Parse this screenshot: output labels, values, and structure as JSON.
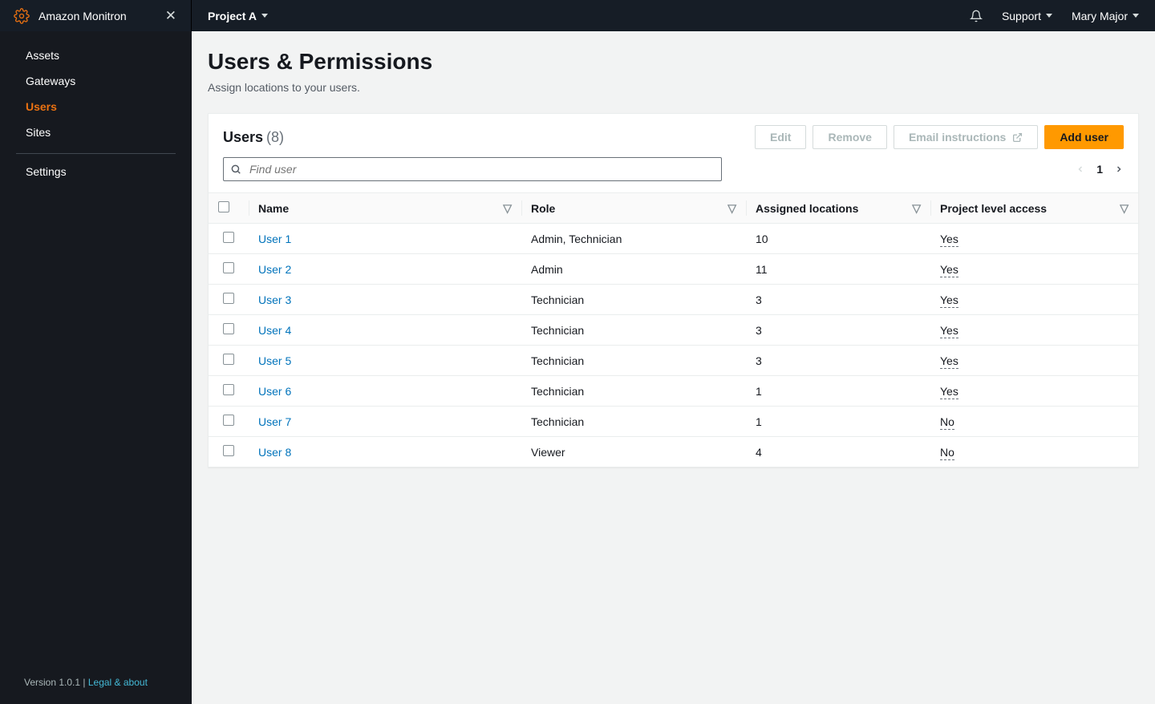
{
  "brand": "Amazon Monitron",
  "project": "Project A",
  "topmenu": {
    "support": "Support",
    "user": "Mary Major"
  },
  "sidebar": {
    "items": [
      "Assets",
      "Gateways",
      "Users",
      "Sites"
    ],
    "active_index": 2,
    "settings": "Settings",
    "version_prefix": "Version 1.0.1 | ",
    "legal": "Legal & about"
  },
  "page": {
    "title": "Users & Permissions",
    "subtitle": "Assign locations to your users."
  },
  "panel": {
    "title": "Users",
    "count": "(8)",
    "actions": {
      "edit": "Edit",
      "remove": "Remove",
      "email": "Email instructions",
      "add": "Add user"
    },
    "search_placeholder": "Find user",
    "page": "1"
  },
  "table": {
    "cols": {
      "name": "Name",
      "role": "Role",
      "locations": "Assigned locations",
      "access": "Project level access"
    },
    "rows": [
      {
        "name": "User 1",
        "role": "Admin, Technician",
        "locations": "10",
        "access": "Yes"
      },
      {
        "name": "User 2",
        "role": "Admin",
        "locations": "11",
        "access": "Yes"
      },
      {
        "name": "User 3",
        "role": "Technician",
        "locations": "3",
        "access": "Yes"
      },
      {
        "name": "User 4",
        "role": "Technician",
        "locations": "3",
        "access": "Yes"
      },
      {
        "name": "User 5",
        "role": "Technician",
        "locations": "3",
        "access": "Yes"
      },
      {
        "name": "User 6",
        "role": "Technician",
        "locations": "1",
        "access": "Yes"
      },
      {
        "name": "User 7",
        "role": "Technician",
        "locations": "1",
        "access": "No"
      },
      {
        "name": "User 8",
        "role": "Viewer",
        "locations": "4",
        "access": "No"
      }
    ]
  }
}
